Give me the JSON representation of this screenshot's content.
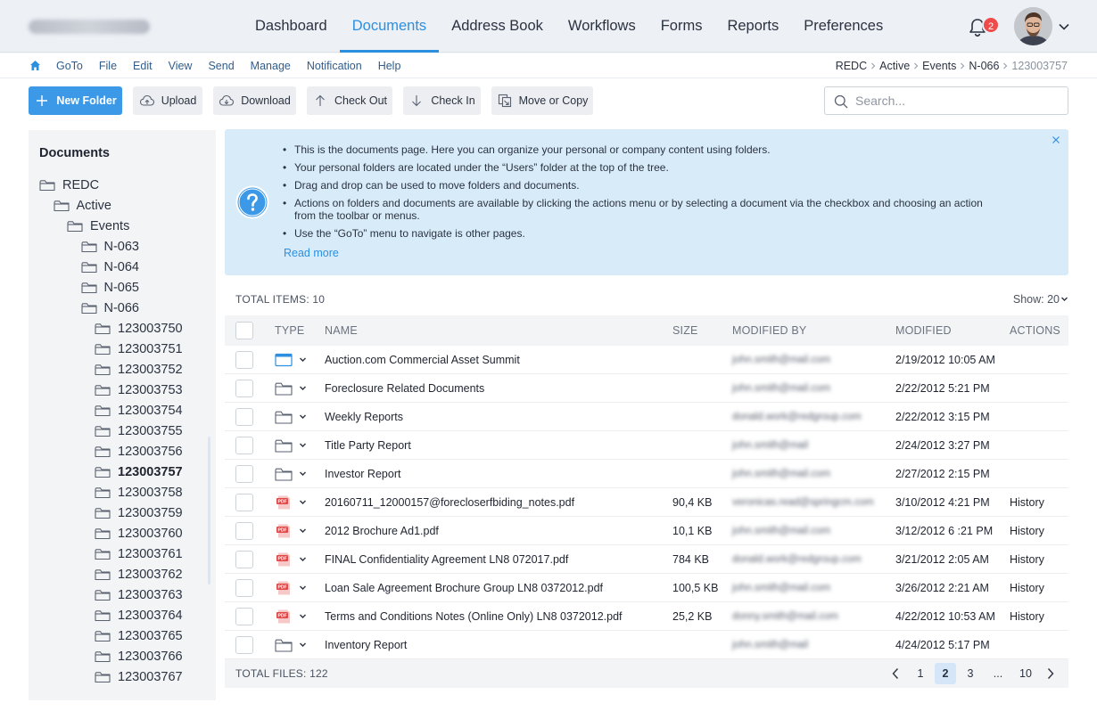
{
  "header": {
    "nav": [
      {
        "label": "Dashboard",
        "active": false
      },
      {
        "label": "Documents",
        "active": true
      },
      {
        "label": "Address Book",
        "active": false
      },
      {
        "label": "Workflows",
        "active": false
      },
      {
        "label": "Forms",
        "active": false
      },
      {
        "label": "Reports",
        "active": false
      },
      {
        "label": "Preferences",
        "active": false
      }
    ],
    "notification_count": "2",
    "accent_color": "#2d8fe0",
    "badge_color": "#ef4b4b"
  },
  "menubar": {
    "items": [
      "GoTo",
      "File",
      "Edit",
      "View",
      "Send",
      "Manage",
      "Notification",
      "Help"
    ],
    "breadcrumb": [
      "REDC",
      "Active",
      "Events",
      "N-066"
    ],
    "breadcrumb_current": "123003757"
  },
  "toolbar": {
    "new_folder": "New Folder",
    "upload": "Upload",
    "download": "Download",
    "check_out": "Check Out",
    "check_in": "Check In",
    "move_or_copy": "Move or Copy",
    "search_placeholder": "Search..."
  },
  "sidebar": {
    "title": "Documents",
    "tree": [
      {
        "label": "REDC",
        "depth": 0
      },
      {
        "label": "Active",
        "depth": 1
      },
      {
        "label": "Events",
        "depth": 2
      },
      {
        "label": "N-063",
        "depth": 3
      },
      {
        "label": "N-064",
        "depth": 3
      },
      {
        "label": "N-065",
        "depth": 3
      },
      {
        "label": "N-066",
        "depth": 3
      },
      {
        "label": "123003750",
        "depth": 4
      },
      {
        "label": "123003751",
        "depth": 4
      },
      {
        "label": "123003752",
        "depth": 4
      },
      {
        "label": "123003753",
        "depth": 4
      },
      {
        "label": "123003754",
        "depth": 4
      },
      {
        "label": "123003755",
        "depth": 4
      },
      {
        "label": "123003756",
        "depth": 4
      },
      {
        "label": "123003757",
        "depth": 4,
        "selected": true
      },
      {
        "label": "123003758",
        "depth": 4
      },
      {
        "label": "123003759",
        "depth": 4
      },
      {
        "label": "123003760",
        "depth": 4
      },
      {
        "label": "123003761",
        "depth": 4
      },
      {
        "label": "123003762",
        "depth": 4
      },
      {
        "label": "123003763",
        "depth": 4
      },
      {
        "label": "123003764",
        "depth": 4
      },
      {
        "label": "123003765",
        "depth": 4
      },
      {
        "label": "123003766",
        "depth": 4
      },
      {
        "label": "123003767",
        "depth": 4
      }
    ]
  },
  "info": {
    "bullets": [
      "This is the documents page. Here you can organize your personal or company content using folders.",
      "Your personal folders are located under the “Users” folder at the top of the tree.",
      "Drag and drop can be used to move folders and documents.",
      "Actions on folders and documents are available by clicking the actions menu or by selecting a document via the checkbox and choosing an action from the toolbar or menus.",
      "Use the “GoTo” menu to navigate is other pages."
    ],
    "read_more": "Read more"
  },
  "table": {
    "total_items": "TOTAL ITEMS: 10",
    "show_label": "Show: 20",
    "columns": {
      "type": "TYPE",
      "name": "NAME",
      "size": "SIZE",
      "modified_by": "MODIFIED BY",
      "modified": "MODIFIED",
      "actions": "ACTIONS"
    },
    "rows": [
      {
        "type": "web",
        "name": "Auction.com Commercial Asset Summit",
        "size": "",
        "modified_by": "john.smith@mail.com",
        "modified": "2/19/2012 10:05 AM",
        "action": ""
      },
      {
        "type": "folder",
        "name": "Foreclosure Related Documents",
        "size": "",
        "modified_by": "john.smith@mail.com",
        "modified": "2/22/2012 5:21 PM",
        "action": ""
      },
      {
        "type": "folder",
        "name": "Weekly Reports",
        "size": "",
        "modified_by": "donald.work@redgroup.com",
        "modified": "2/22/2012 3:15 PM",
        "action": ""
      },
      {
        "type": "folder",
        "name": "Title Party Report",
        "size": "",
        "modified_by": "john.smith@mail",
        "modified": "2/24/2012 3:27 PM",
        "action": ""
      },
      {
        "type": "folder",
        "name": "Investor Report",
        "size": "",
        "modified_by": "john.smith@mail.com",
        "modified": "2/27/2012 2:15 PM",
        "action": ""
      },
      {
        "type": "pdf",
        "name": "20160711_12000157@forecloserfbiding_notes.pdf",
        "size": "90,4 KB",
        "modified_by": "veronicas.read@springcm.com",
        "modified": "3/10/2012 4:21 PM",
        "action": "History"
      },
      {
        "type": "pdf",
        "name": "2012 Brochure Ad1.pdf",
        "size": "10,1 KB",
        "modified_by": "john.smith@mail.com",
        "modified": "3/12/2012 6 :21 PM",
        "action": "History"
      },
      {
        "type": "pdf",
        "name": "FINAL Confidentiality Agreement LN8 072017.pdf",
        "size": "784 KB",
        "modified_by": "donald.work@redgroup.com",
        "modified": "3/21/2012 2:05 AM",
        "action": "History"
      },
      {
        "type": "pdf",
        "name": "Loan Sale Agreement Brochure Group LN8 0372012.pdf",
        "size": "100,5 KB",
        "modified_by": "john.smith@mail.com",
        "modified": "3/26/2012 2:21 AM",
        "action": "History"
      },
      {
        "type": "pdf",
        "name": "Terms and Conditions Notes (Online Only) LN8 0372012.pdf",
        "size": "25,2 KB",
        "modified_by": "donny.smith@mail.com",
        "modified": "4/22/2012 10:53 AM",
        "action": "History"
      },
      {
        "type": "folder",
        "name": "Inventory Report",
        "size": "",
        "modified_by": "john.smith@mail",
        "modified": "4/24/2012 5:17 PM",
        "action": ""
      }
    ],
    "total_files": "TOTAL FILES: 122",
    "pages": [
      "1",
      "2",
      "3"
    ],
    "current_page": "2",
    "ellipsis": "...",
    "last_page": "10"
  }
}
